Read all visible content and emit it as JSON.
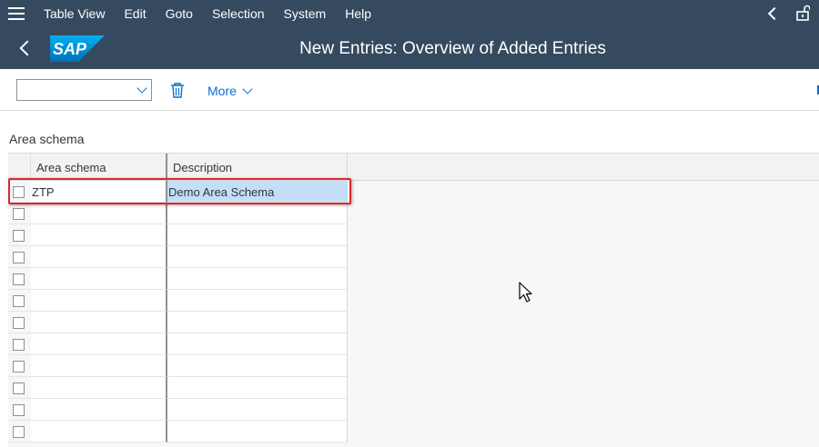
{
  "menu": {
    "items": [
      {
        "label": "Table View"
      },
      {
        "label": "Edit"
      },
      {
        "label": "Goto"
      },
      {
        "label": "Selection"
      },
      {
        "label": "System"
      },
      {
        "label": "Help"
      }
    ]
  },
  "header": {
    "logo_text": "SAP",
    "title": "New Entries: Overview of Added Entries"
  },
  "toolbar": {
    "dropdown_value": "",
    "more_label": "More"
  },
  "section": {
    "title": "Area schema"
  },
  "table": {
    "columns": [
      "Area schema",
      "Description"
    ],
    "rows": [
      {
        "area_schema": "ZTP",
        "description": "Demo Area Schema"
      },
      {
        "area_schema": "",
        "description": ""
      },
      {
        "area_schema": "",
        "description": ""
      },
      {
        "area_schema": "",
        "description": ""
      },
      {
        "area_schema": "",
        "description": ""
      },
      {
        "area_schema": "",
        "description": ""
      },
      {
        "area_schema": "",
        "description": ""
      },
      {
        "area_schema": "",
        "description": ""
      },
      {
        "area_schema": "",
        "description": ""
      },
      {
        "area_schema": "",
        "description": ""
      },
      {
        "area_schema": "",
        "description": ""
      },
      {
        "area_schema": "",
        "description": ""
      }
    ]
  },
  "colors": {
    "shell": "#354a5f",
    "accent": "#0a6ed1",
    "highlight": "#d9282f",
    "selected_cell": "#c4def7"
  }
}
